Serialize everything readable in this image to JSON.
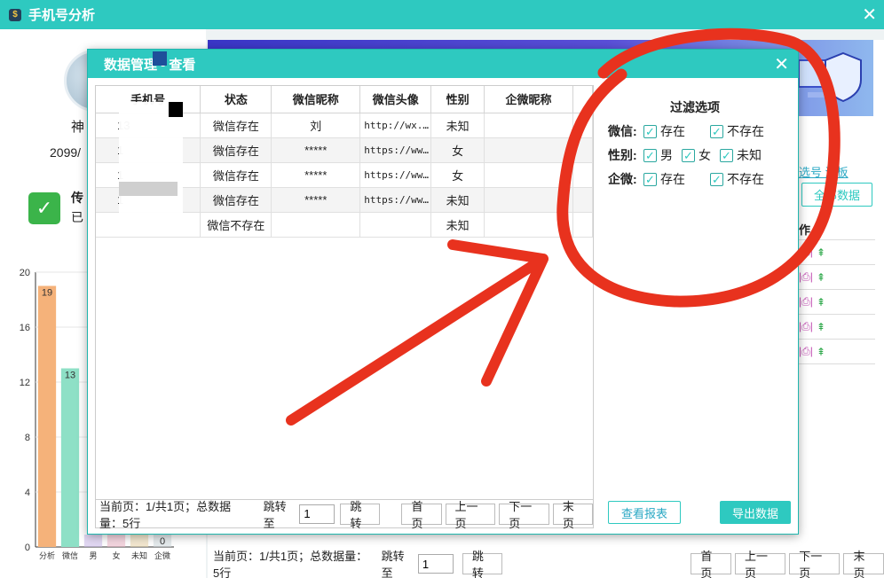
{
  "window": {
    "title": "手机号分析"
  },
  "left": {
    "name": "神",
    "date": "2099/",
    "msg1": "传",
    "msg2": "已"
  },
  "chart_data": {
    "type": "bar",
    "categories": [
      "分析",
      "微信",
      "男",
      "女",
      "未知",
      "企微"
    ],
    "values": [
      19,
      13,
      0,
      0,
      0,
      0
    ],
    "value_labels": [
      "19",
      "13",
      "",
      "",
      "",
      "0"
    ],
    "yticks": [
      "0",
      "4",
      "8",
      "12",
      "16",
      "20"
    ],
    "ylim": [
      0,
      20
    ],
    "colors": [
      "#f5b27a",
      "#8ee0c6",
      "#c9b6e8",
      "#e9b3c5",
      "#e8d4a8",
      "#cfd8dc"
    ],
    "grid": true
  },
  "background": {
    "link_text": "选号 清板",
    "all_data_label": "全部数据",
    "op_header": "作",
    "ops": [
      "查看",
      "导出",
      "置顶"
    ],
    "footer": {
      "info": "当前页：1/共1页；总数据量：5行",
      "jump_to": "跳转至",
      "page_value": "1",
      "jump": "跳转",
      "first": "首页",
      "prev": "上一页",
      "next": "下一页",
      "last": "末页"
    }
  },
  "modal": {
    "title": "数据管理 - 查看",
    "columns": [
      "手机号",
      "状态",
      "微信昵称",
      "微信头像",
      "性别",
      "企微昵称"
    ],
    "rows": [
      {
        "phone": "13",
        "status": "微信存在",
        "nickname": "刘",
        "avatar": "http://wx.…",
        "gender": "未知",
        "wework": ""
      },
      {
        "phone": "1",
        "status": "微信存在",
        "nickname": "*****",
        "avatar": "https://ww…",
        "gender": "女",
        "wework": ""
      },
      {
        "phone": "1",
        "status": "微信存在",
        "nickname": "*****",
        "avatar": "https://ww…",
        "gender": "女",
        "wework": ""
      },
      {
        "phone": "1",
        "status": "微信存在",
        "nickname": "*****",
        "avatar": "https://ww…",
        "gender": "未知",
        "wework": ""
      },
      {
        "phone": "",
        "status": "微信不存在",
        "nickname": "",
        "avatar": "",
        "gender": "未知",
        "wework": ""
      }
    ],
    "footer": {
      "info": "当前页：1/共1页；总数据量：5行",
      "jump_to": "跳转至",
      "page_value": "1",
      "jump": "跳转",
      "first": "首页",
      "prev": "上一页",
      "next": "下一页",
      "last": "末页"
    },
    "filter": {
      "title": "过滤选项",
      "wechat_label": "微信:",
      "wechat_exist": "存在",
      "wechat_not_exist": "不存在",
      "gender_label": "性别:",
      "male": "男",
      "female": "女",
      "unknown": "未知",
      "wework_label": "企微:",
      "wework_exist": "存在",
      "wework_not_exist": "不存在"
    },
    "report_button": "查看报表",
    "export_button": "导出数据"
  },
  "annotation_color": "#e8321e"
}
